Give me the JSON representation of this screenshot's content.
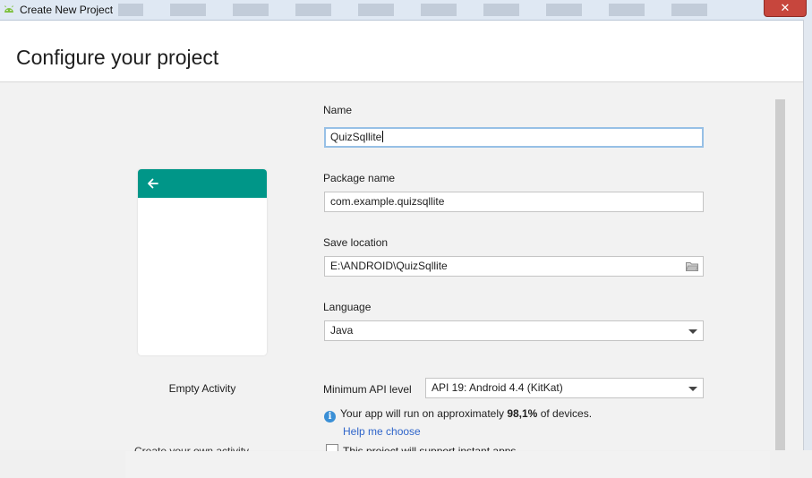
{
  "window": {
    "title": "Create New Project",
    "close_label": "✕"
  },
  "page": {
    "title": "Configure your project"
  },
  "template": {
    "name": "Empty Activity",
    "partial_option": "Create your own activity"
  },
  "form": {
    "name_label": "Name",
    "name_value": "QuizSqllite",
    "package_label": "Package name",
    "package_value": "com.example.quizsqllite",
    "location_label": "Save location",
    "location_value": "E:\\ANDROID\\QuizSqllite",
    "language_label": "Language",
    "language_value": "Java",
    "min_api_label": "Minimum API level",
    "min_api_value": "API 19: Android 4.4 (KitKat)"
  },
  "info": {
    "prefix": "Your app will run on approximately ",
    "percent": "98,1%",
    "suffix": " of devices.",
    "help_link": "Help me choose"
  },
  "checkbox": {
    "label": "This project will support instant apps"
  },
  "colors": {
    "accent": "#009688",
    "link": "#2f65ca",
    "focus": "#97c0e6",
    "info": "#3a8fd6"
  }
}
